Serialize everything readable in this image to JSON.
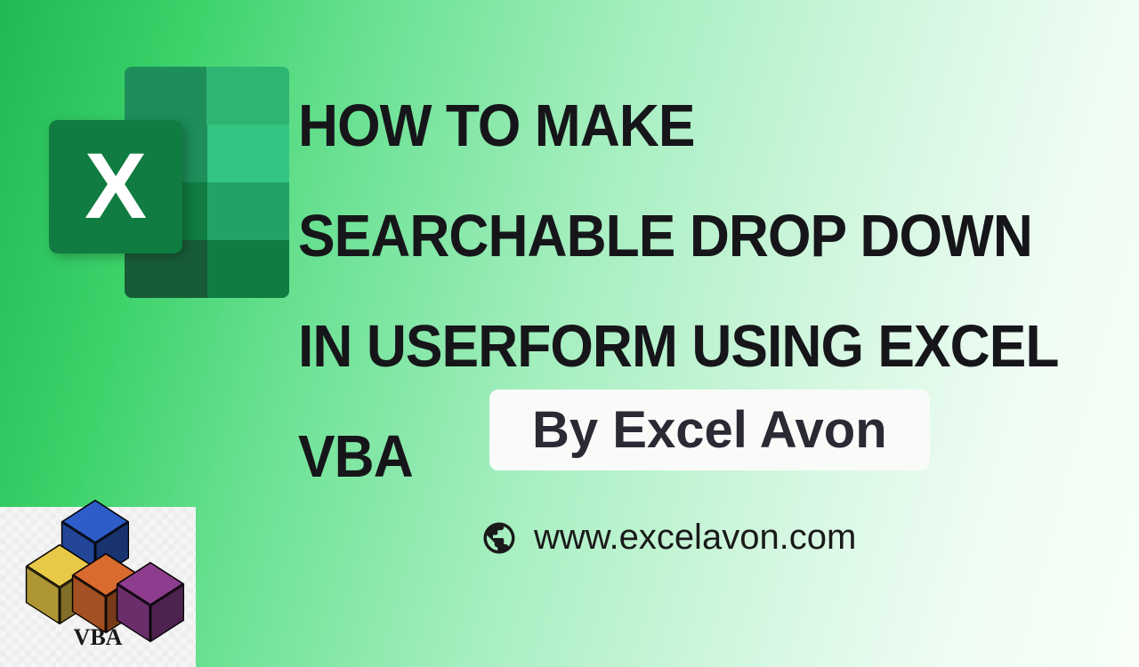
{
  "title": "HOW TO MAKE SEARCHABLE DROP DOWN IN USERFORM USING EXCEL VBA",
  "author": {
    "label": "By Excel Avon"
  },
  "website": {
    "url": "www.excelavon.com"
  },
  "icons": {
    "excel_letter": "X",
    "vba_label": "VBA"
  },
  "colors": {
    "gradient_start": "#1fb954",
    "gradient_end": "#f8fef9",
    "excel_primary": "#107c41",
    "text_dark": "#16161a"
  }
}
